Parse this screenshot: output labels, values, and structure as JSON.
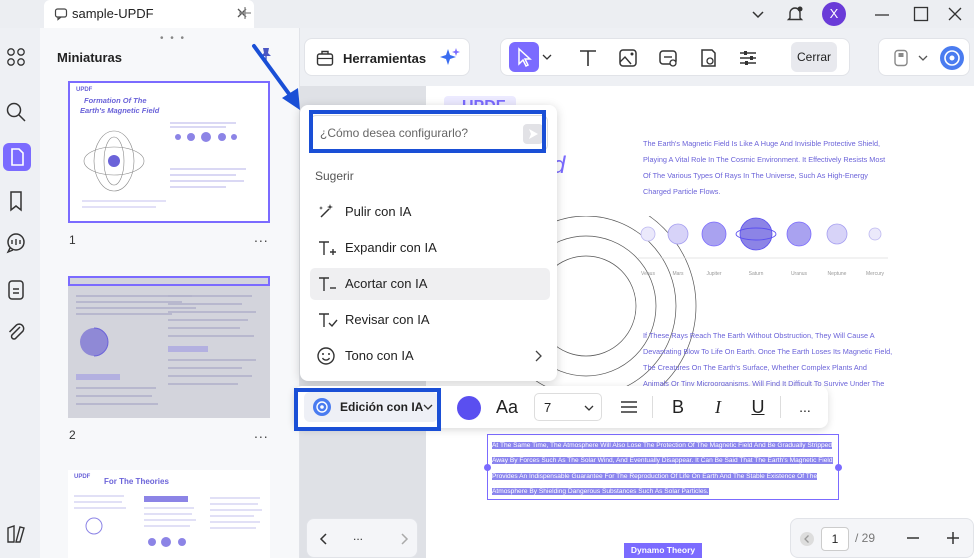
{
  "titlebar": {
    "tab_title": "sample-UPDF",
    "user_avatar_letter": "X",
    "accent": "#7b6bff",
    "avatar_color": "#6a3bd8"
  },
  "sidebar": {
    "panel_title": "Miniaturas",
    "pages": [
      {
        "number": "1",
        "more": "..."
      },
      {
        "number": "2",
        "more": "..."
      },
      {
        "number": "",
        "more": ""
      }
    ]
  },
  "toolbar": {
    "tools_label": "Herramientas",
    "close_label": "Cerrar"
  },
  "thumbnails": {
    "p1_title_a": "Formation Of The",
    "p1_title_b": "Earth's Magnetic Field",
    "p3_title": "For The Theories",
    "logo": "UPDF"
  },
  "popup": {
    "input_placeholder": "¿Cómo desea configurarlo?",
    "section_label": "Sugerir",
    "items": [
      {
        "label": "Pulir con IA",
        "icon": "magic-wand-icon"
      },
      {
        "label": "Expandir con IA",
        "icon": "text-expand-icon"
      },
      {
        "label": "Acortar con IA",
        "icon": "text-shorten-icon"
      },
      {
        "label": "Revisar con IA",
        "icon": "text-check-icon"
      },
      {
        "label": "Tono con IA",
        "icon": "smile-icon"
      }
    ]
  },
  "format_bar": {
    "ai_edit_label": "Edición con IA",
    "font_size": "7",
    "color": "#5a4ff0",
    "font_label": "Aa",
    "bold": "B",
    "italic": "I",
    "underline": "U",
    "more": "..."
  },
  "document": {
    "logo": "UPDF",
    "para1": "The Earth's Magnetic Field Is Like A Huge And Invisible Protective Shield, Playing A Vital Role In The Cosmic Environment. It Effectively Resists Most Of The Various Types Of Rays In The Universe, Such As High-Energy Charged Particle Flows.",
    "planets": [
      "Venus",
      "Mars",
      "Jupiter",
      "Saturn",
      "Uranus",
      "Neptune",
      "Mercury"
    ],
    "para2": "If These Rays Reach The Earth Without Obstruction, They Will Cause A Devastating Blow To Life On Earth. Once The Earth Loses Its Magnetic Field, The Creatures On The Earth's Surface, Whether Complex Plants And Animals Or Tiny Microorganisms, Will Find It Difficult To Survive Under The Direct Impact Of Cosmic Rays.",
    "selected_text": "At The Same Time, The Atmosphere Will Also Lose The Protection Of The Magnetic Field And Be Gradually Stripped Away By Forces Such As The Solar Wind, And Eventually Disappear. It Can Be Said That The Earth's Magnetic Field Provides An Indispensable Guarantee For The Reproduction Of Life On Earth And The Stable Existence Of The Atmosphere By Shielding Dangerous Substances Such As Solar Particles.",
    "bottom_heading": "Dynamo Theory"
  },
  "pagination": {
    "current_page": "1",
    "total_pages": "/ 29",
    "more": "..."
  },
  "annotations": {
    "highlight_color": "#1a4fd6"
  }
}
